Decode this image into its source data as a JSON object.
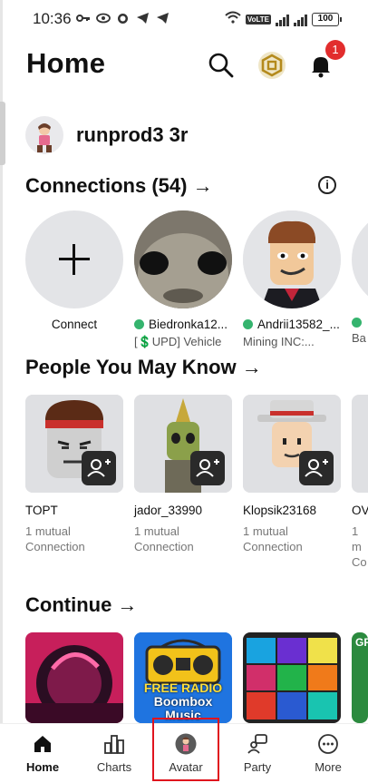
{
  "status_bar": {
    "time": "10:36",
    "network": "VoLTE",
    "battery": "100"
  },
  "header": {
    "title": "Home",
    "icons": [
      "search-icon",
      "robux-icon",
      "bell-icon"
    ],
    "notification_count": "1"
  },
  "profile": {
    "username": "runprod3 3r"
  },
  "connections": {
    "title": "Connections (54) →",
    "info_icon": "info-icon",
    "items": [
      {
        "name": "Connect",
        "sub": ""
      },
      {
        "name": "Biedronka12...",
        "sub": "[💲UPD] Vehicle",
        "online": true
      },
      {
        "name": "Andrii13582_...",
        "sub": "Mining INC:...",
        "online": true
      },
      {
        "name": "",
        "sub": "Ba",
        "online": true
      }
    ]
  },
  "people_you_may_know": {
    "title": "People You May Know →",
    "items": [
      {
        "name": "TOPT",
        "mutual": "1 mutual",
        "detail": "Connection"
      },
      {
        "name": "jador_33990",
        "mutual": "1 mutual",
        "detail": "Connection"
      },
      {
        "name": "Klopsik23168",
        "mutual": "1 mutual",
        "detail": "Connection"
      },
      {
        "name": "OV",
        "mutual": "1 m",
        "detail": "Co"
      }
    ]
  },
  "continue": {
    "title": "Continue →",
    "game_texts": [
      "FREE RADIO",
      "Boombox",
      "Music",
      "GR"
    ]
  },
  "bottom_nav": {
    "items": [
      {
        "label": "Home",
        "icon": "home-icon"
      },
      {
        "label": "Charts",
        "icon": "charts-icon"
      },
      {
        "label": "Avatar",
        "icon": "avatar-icon"
      },
      {
        "label": "Party",
        "icon": "party-icon"
      },
      {
        "label": "More",
        "icon": "more-icon"
      }
    ],
    "active": "Home"
  },
  "colors": {
    "accent_red": "#e0141e",
    "online_green": "#35b46e",
    "badge_red": "#e22d2d"
  }
}
